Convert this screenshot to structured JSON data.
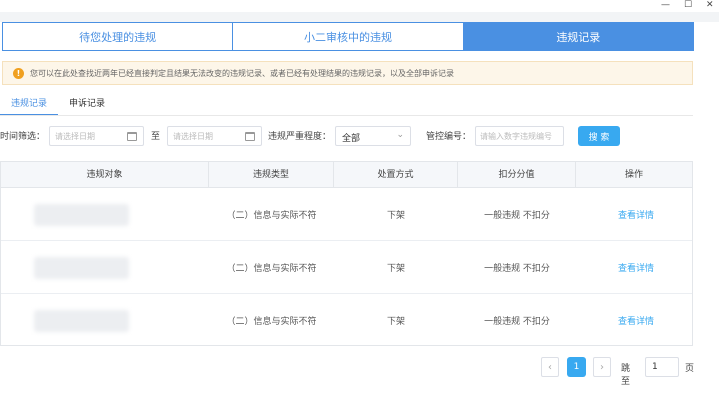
{
  "window": {
    "min_glyph": "—",
    "max_glyph": "☐",
    "close_glyph": "✕"
  },
  "top_tabs": [
    {
      "label": "待您处理的违规",
      "active": false
    },
    {
      "label": "小二审核中的违规",
      "active": false
    },
    {
      "label": "违规记录",
      "active": true
    }
  ],
  "notice": {
    "icon": "!",
    "text": "您可以在此处查找近两年已经直接判定且结果无法改变的违规记录、或者已经有处理结果的违规记录，以及全部申诉记录"
  },
  "sub_tabs": [
    {
      "label": "违规记录",
      "active": true
    },
    {
      "label": "申诉记录",
      "active": false
    }
  ],
  "filters": {
    "time_label": "时间筛选：",
    "start_placeholder": "请选择日期",
    "to_label": "至",
    "end_placeholder": "请选择日期",
    "severity_label": "违规严重程度：",
    "severity_value": "全部",
    "control_label": "管控编号：",
    "control_placeholder": "请输入数字违规编号",
    "search_label": "搜 索"
  },
  "table": {
    "columns": [
      "违规对象",
      "违规类型",
      "处置方式",
      "扣分分值",
      "操作"
    ],
    "rows": [
      {
        "type": "（二）信息与实际不符",
        "action": "下架",
        "points": "一般违规 不扣分",
        "op": "查看详情"
      },
      {
        "type": "（二）信息与实际不符",
        "action": "下架",
        "points": "一般违规 不扣分",
        "op": "查看详情"
      },
      {
        "type": "（二）信息与实际不符",
        "action": "下架",
        "points": "一般违规 不扣分",
        "op": "查看详情"
      }
    ]
  },
  "pagination": {
    "prev": "‹",
    "current": "1",
    "next": "›",
    "goto_label": "跳至",
    "goto_value": "1",
    "page_label": "页"
  },
  "colors": {
    "accent": "#4a90e2",
    "button": "#38a9f0",
    "notice_bg": "#fdf6e9",
    "warning": "#f0a020"
  }
}
